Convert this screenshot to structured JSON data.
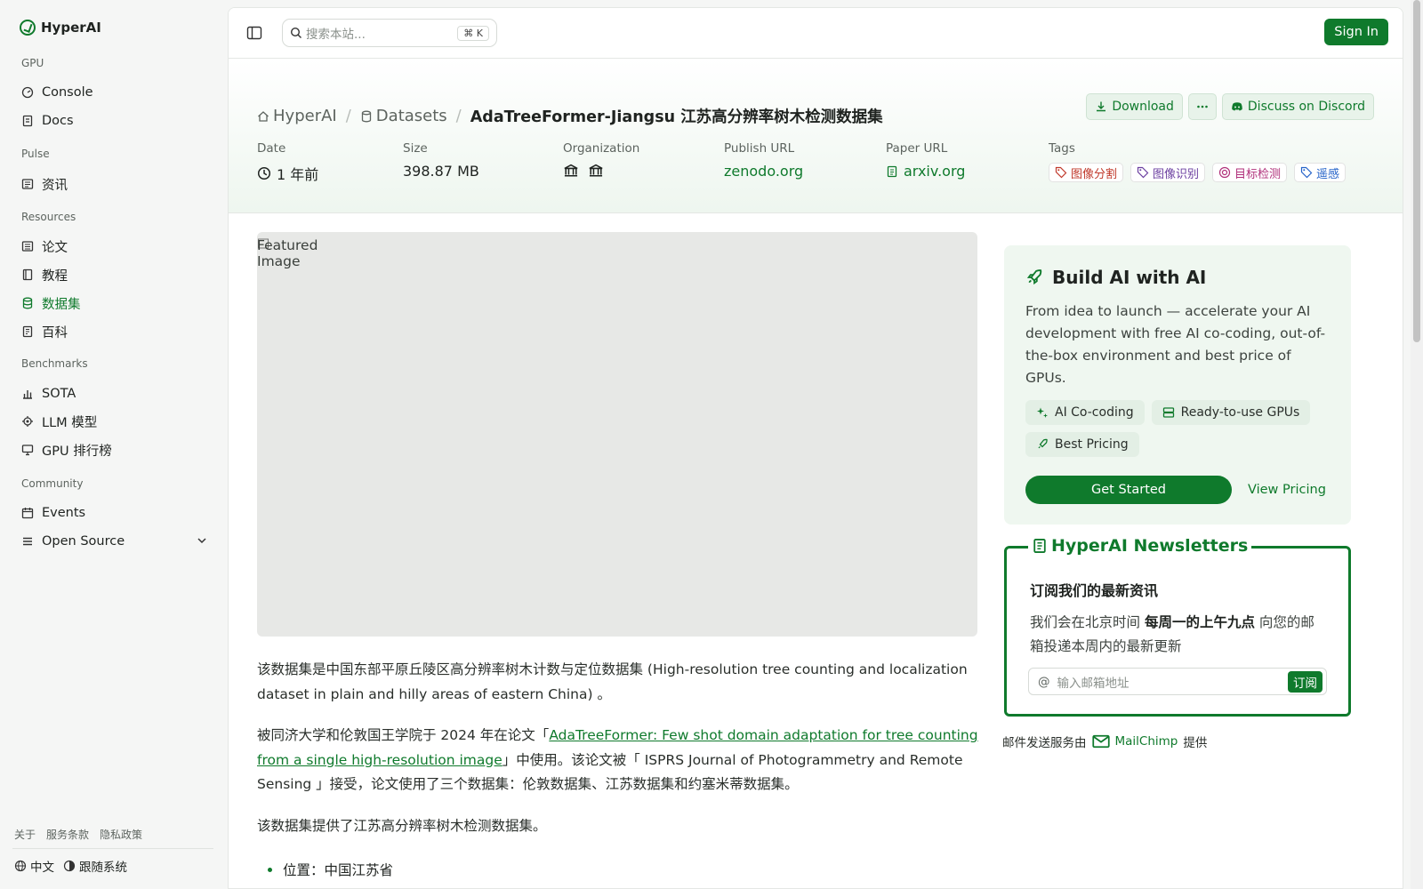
{
  "sidebar": {
    "brand": "HyperAI",
    "groups": {
      "gpu": "GPU",
      "pulse": "Pulse",
      "resources": "Resources",
      "benchmarks": "Benchmarks",
      "community": "Community"
    },
    "items": {
      "console": "Console",
      "docs": "Docs",
      "news": "资讯",
      "papers": "论文",
      "tutorials": "教程",
      "datasets": "数据集",
      "wiki": "百科",
      "sota": "SOTA",
      "llm": "LLM 模型",
      "gpu_rank": "GPU 排行榜",
      "events": "Events",
      "open_source": "Open Source"
    },
    "footer": {
      "about": "关于",
      "terms": "服务条款",
      "privacy": "隐私政策",
      "language": "中文",
      "theme": "跟随系统"
    }
  },
  "topbar": {
    "search_placeholder": "搜索本站...",
    "shortcut": "K",
    "signin": "Sign In"
  },
  "header": {
    "crumbs": {
      "home": "HyperAI",
      "datasets": "Datasets",
      "current_en": "AdaTreeFormer-Jiangsu",
      "current_zh": "江苏高分辨率树木检测数据集"
    },
    "actions": {
      "download": "Download",
      "discord": "Discuss on Discord"
    },
    "meta": {
      "date_label": "Date",
      "date_value": "1 年前",
      "size_label": "Size",
      "size_value": "398.87 MB",
      "org_label": "Organization",
      "publish_label": "Publish URL",
      "publish_value": "zenodo.org",
      "paper_label": "Paper URL",
      "paper_value": "arxiv.org",
      "tags_label": "Tags"
    },
    "tags": [
      "图像分割",
      "图像识别",
      "目标检测",
      "遥感"
    ]
  },
  "colors": {
    "accent": "#0f7a2c",
    "tag_red": "#c0392b",
    "tag_purple": "#6b3fa0",
    "tag_pink": "#b0307a",
    "tag_blue": "#2563c9"
  },
  "content": {
    "featured_alt": "Featured Image",
    "p1": "该数据集是中国东部平原丘陵区高分辨率树木计数与定位数据集 (High-resolution tree counting and localization dataset in plain and hilly areas of eastern China) 。",
    "p2_before": "被同济大学和伦敦国王学院于 2024 年在论文「",
    "p2_link": "AdaTreeFormer: Few shot domain adaptation for tree counting from a single high-resolution image",
    "p2_after": "」中使用。该论文被「 ISPRS Journal of Photogrammetry and Remote Sensing 」接受，论文使用了三个数据集：伦敦数据集、江苏数据集和约塞米蒂数据集。",
    "p3": "该数据集提供了江苏高分辨率树木检测数据集。",
    "bullet1": "位置：中国江苏省"
  },
  "build_card": {
    "title": "Build AI with AI",
    "description": "From idea to launch — accelerate your AI development with free AI co-coding, out-of-the-box environment and best price of GPUs.",
    "features": [
      "AI Co-coding",
      "Ready-to-use GPUs",
      "Best Pricing"
    ],
    "cta": "Get Started",
    "pricing": "View Pricing"
  },
  "newsletter": {
    "title": "HyperAI Newsletters",
    "heading": "订阅我们的最新资讯",
    "desc_before": "我们会在北京时间 ",
    "desc_bold": "每周一的上午九点",
    "desc_after": " 向您的邮箱投递本周内的最新更新",
    "email_placeholder": "输入邮箱地址",
    "subscribe": "订阅",
    "service_before": "邮件发送服务由",
    "service_name": "MailChimp",
    "service_after": "提供"
  }
}
